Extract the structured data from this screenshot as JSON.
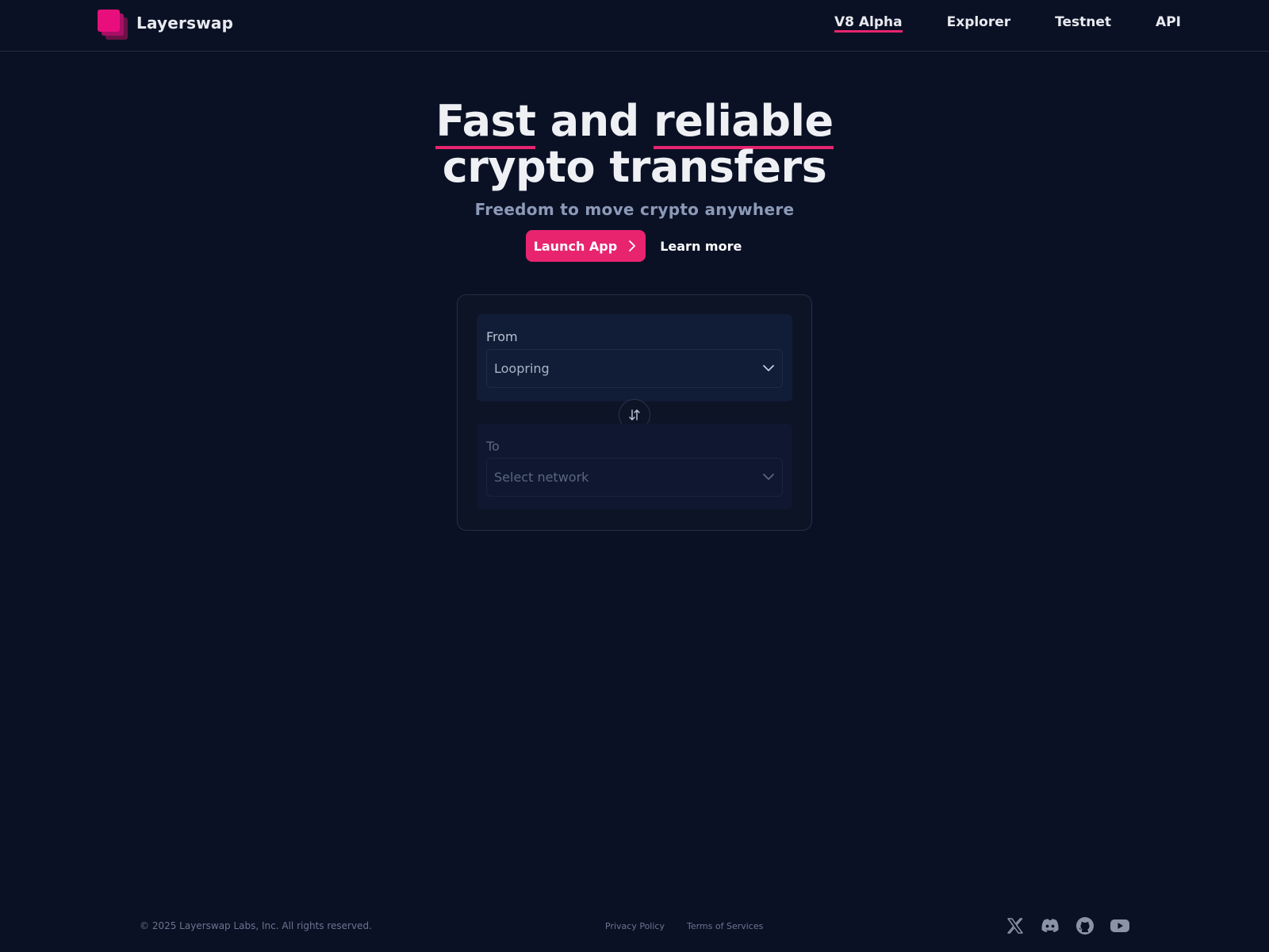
{
  "header": {
    "brand": "Layerswap",
    "nav": [
      {
        "label": "V8 Alpha",
        "active": true
      },
      {
        "label": "Explorer"
      },
      {
        "label": "Testnet"
      },
      {
        "label": "API"
      }
    ]
  },
  "hero": {
    "title_word1": "Fast",
    "title_word2": "and",
    "title_word3": "reliable",
    "title_line2": "crypto transfers",
    "subtitle": "Freedom to move crypto anywhere",
    "launch_label": "Launch App",
    "learn_label": "Learn more"
  },
  "swap": {
    "from_label": "From",
    "from_value": "Loopring",
    "to_label": "To",
    "to_placeholder": "Select network"
  },
  "footer": {
    "copyright": "© 2025 Layerswap Labs, Inc. All rights reserved.",
    "privacy": "Privacy Policy",
    "terms": "Terms of Services",
    "social": [
      "x-icon",
      "discord-icon",
      "github-icon",
      "youtube-icon"
    ]
  },
  "colors": {
    "background": "#0b1125",
    "accent": "#e8246f",
    "logo": "#e80f7c"
  }
}
